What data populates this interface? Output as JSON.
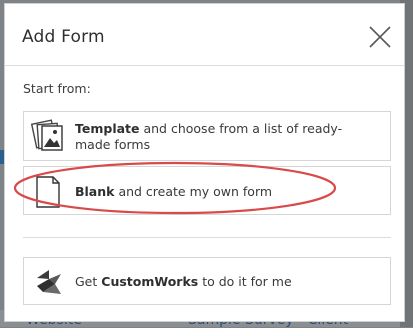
{
  "dialog": {
    "title": "Add Form",
    "close_icon": "close-icon",
    "start_label": "Start from:",
    "options": {
      "template": {
        "bold": "Template",
        "rest": " and choose from a list of ready-made forms",
        "icon": "images-icon"
      },
      "blank": {
        "bold": "Blank",
        "rest": " and create my own form",
        "icon": "blank-page-icon"
      },
      "custom": {
        "pre": "Get ",
        "bold": "CustomWorks",
        "rest": " to do it for me",
        "icon": "customworks-logo-icon"
      }
    },
    "annotation_color": "#d94a4a"
  },
  "background": {
    "left_text": "Website",
    "right_text": "Sample Survey - Client"
  }
}
